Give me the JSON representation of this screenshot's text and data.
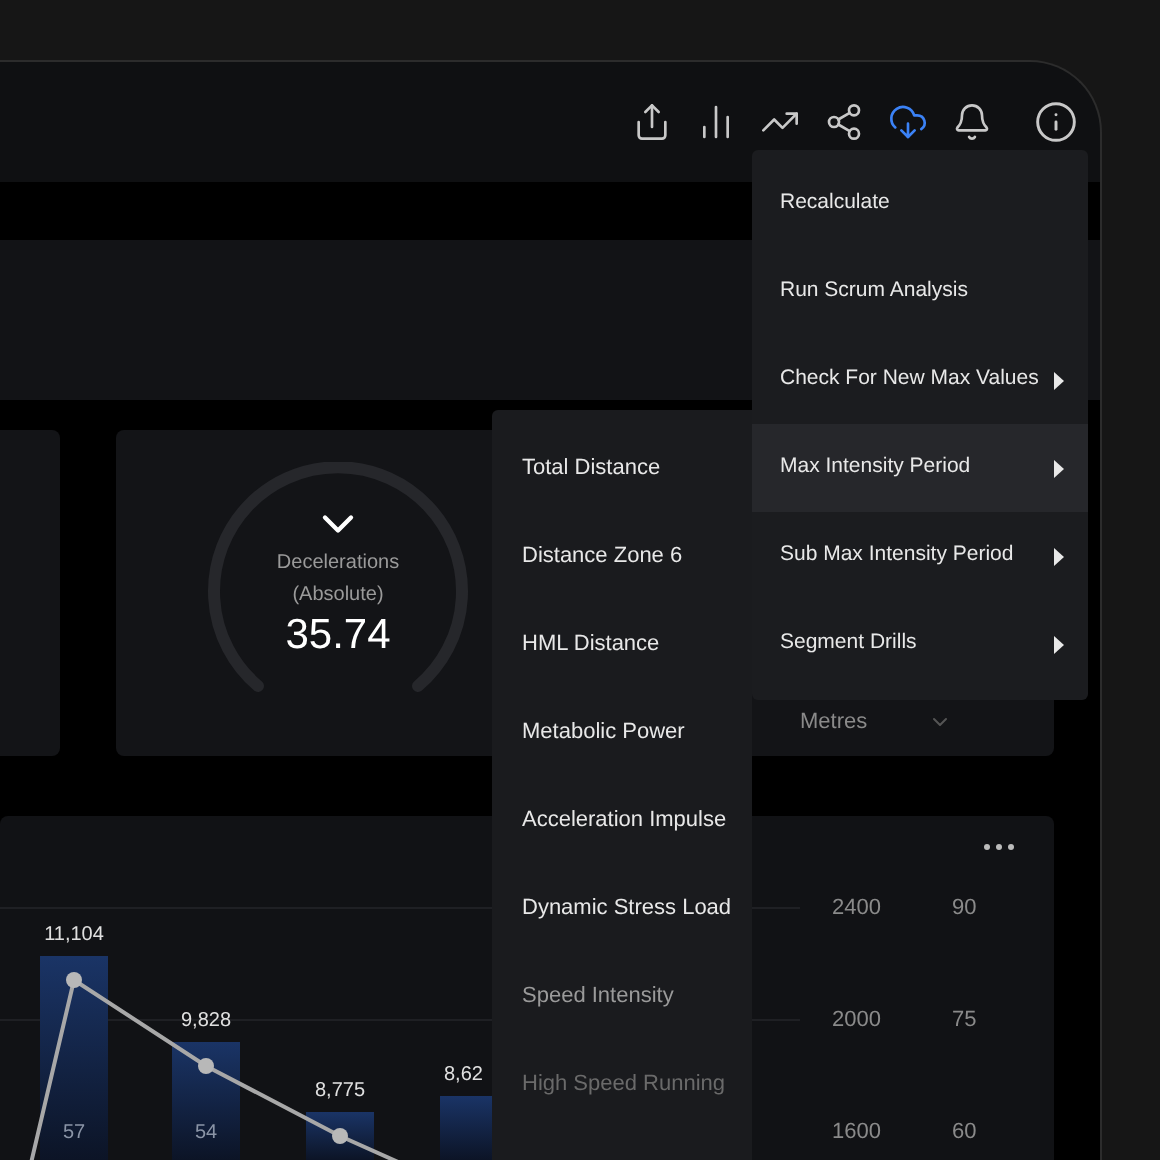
{
  "toolbar": [
    {
      "kind": "export",
      "selected": false
    },
    {
      "kind": "bars",
      "selected": false
    },
    {
      "kind": "trend",
      "selected": false
    },
    {
      "kind": "share",
      "selected": false
    },
    {
      "kind": "cloud",
      "selected": true
    },
    {
      "kind": "bell",
      "selected": false
    },
    {
      "kind": "info",
      "selected": false
    }
  ],
  "gauge_card": {
    "label": "Decelerations",
    "sublabel": "(Absolute)",
    "value": "35.74"
  },
  "unit_card": {
    "unit": "Metres"
  },
  "chart_panel": {
    "left_ticks": [
      "2400",
      "2000",
      "1600"
    ],
    "right_ticks": [
      "90",
      "75",
      "60"
    ],
    "bars": [
      {
        "value_label": "11,104",
        "count_label": "57"
      },
      {
        "value_label": "9,828",
        "count_label": "54"
      },
      {
        "value_label": "8,775"
      },
      {
        "value_label": "8,62"
      }
    ]
  },
  "menu": {
    "items": [
      {
        "label": "Recalculate",
        "submenu": false,
        "selected": false
      },
      {
        "label": "Run Scrum Analysis",
        "submenu": false,
        "selected": false
      },
      {
        "label": "Check For New Max Values",
        "submenu": true,
        "selected": false
      },
      {
        "label": "Max Intensity Period",
        "submenu": true,
        "selected": true
      },
      {
        "label": "Sub Max Intensity Period",
        "submenu": true,
        "selected": false
      },
      {
        "label": "Segment Drills",
        "submenu": true,
        "selected": false
      }
    ]
  },
  "submenu": {
    "items": [
      "Total Distance",
      "Distance Zone 6",
      "HML Distance",
      "Metabolic Power",
      "Acceleration Impulse",
      "Dynamic Stress Load",
      "Speed Intensity",
      "High Speed Running"
    ]
  }
}
